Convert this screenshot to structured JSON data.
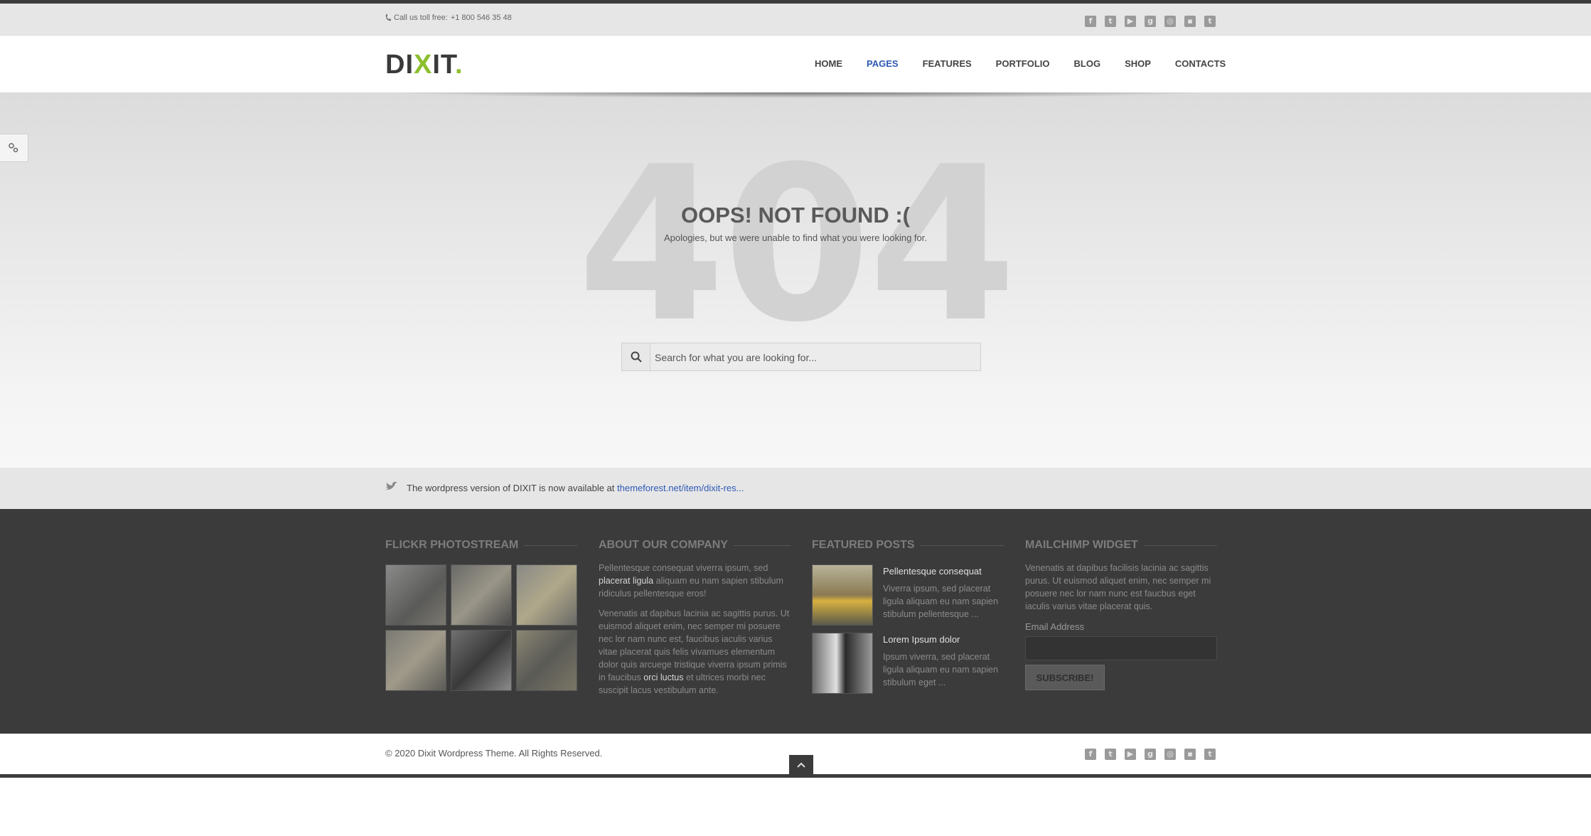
{
  "topbar": {
    "phone_label": "Call us toll free:",
    "phone_number": "+1 800 546 35 48",
    "social": [
      "f",
      "t",
      "yt",
      "g+",
      "d",
      "fl",
      "t."
    ]
  },
  "header": {
    "logo_main": "DI",
    "logo_x": "X",
    "logo_end": "IT",
    "logo_dot": ".",
    "nav": [
      "HOME",
      "PAGES",
      "FEATURES",
      "PORTFOLIO",
      "BLOG",
      "SHOP",
      "CONTACTS"
    ],
    "active_nav": "PAGES",
    "accent": "#8cbf2e",
    "link_color": "#2f59b5"
  },
  "hero": {
    "big_number": "404",
    "title": "OOPS! NOT FOUND :(",
    "subtitle": "Apologies, but we were unable to find what you were looking for.",
    "search_placeholder": "Search for what you are looking for..."
  },
  "tweet": {
    "text": "The wordpress version of DIXIT is now available at ",
    "link": "themeforest.net/item/dixit-res",
    "ellipsis": "..."
  },
  "footer": {
    "flickr_title": "FLICKR PHOTOSTREAM",
    "about_title": "ABOUT OUR COMPANY",
    "about_p1_a": "Pellentesque consequat viverra ipsum, sed ",
    "about_p1_b": "placerat ligula",
    "about_p1_c": " aliquam eu nam sapien stibulum ridiculus pellentesque eros!",
    "about_p2_a": "Venenatis at dapibus lacinia ac sagittis purus. Ut euismod aliquet enim, nec semper mi posuere nec lor nam nunc est, faucibus iaculis varius vitae placerat quis felis vivamues elementum dolor quis arcuege tristique viverra ipsum primis in faucibus ",
    "about_p2_b": "orci luctus",
    "about_p2_c": " et ultrices morbi nec suscipit lacus vestibulum ante.",
    "featured_title": "FEATURED POSTS",
    "posts": [
      {
        "title": "Pellentesque consequat",
        "excerpt": "Viverra ipsum, sed placerat ligula aliquam eu nam sapien stibulum pellentesque ..."
      },
      {
        "title": "Lorem Ipsum dolor",
        "excerpt": "Ipsum viverra, sed placerat ligula aliquam eu nam sapien stibulum eget ..."
      }
    ],
    "mailchimp_title": "MAILCHIMP WIDGET",
    "mailchimp_text": "Venenatis at dapibus facilisis lacinia ac sagittis purus. Ut euismod aliquet enim, nec semper mi posuere nec lor nam nunc est faucbus eget iaculis varius vitae placerat quis.",
    "email_label": "Email Address",
    "subscribe_label": "SUBSCRIBE!"
  },
  "bottom": {
    "copyright": "© 2020 Dixit Wordpress Theme. All Rights Reserved."
  }
}
